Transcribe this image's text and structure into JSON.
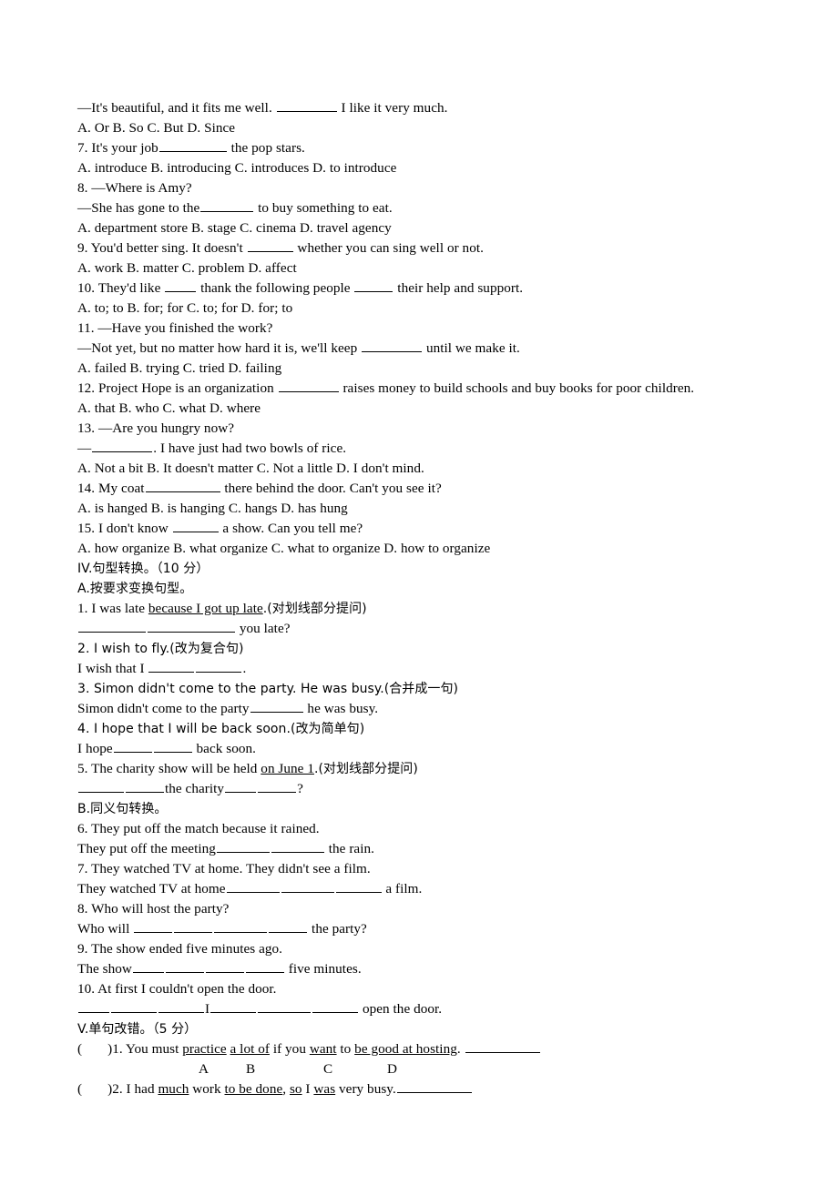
{
  "document": {
    "type": "english-exam-worksheet",
    "language": "en-zh",
    "page_background": "#ffffff",
    "text_color": "#000000"
  },
  "lines": {
    "q6_stem": "—It's beautiful, and it fits me well. ",
    "q6_tail": " I like it very much.",
    "q6_options": "A. Or B. So C. But D. Since",
    "q7_stem": "7. It's your job",
    "q7_tail": " the pop stars.",
    "q7_options": "A. introduce B. introducing C. introduces D. to introduce",
    "q8_stem": "8.  —Where is Amy?",
    "q8_line2_a": "—She has gone to the",
    "q8_line2_b": " to buy something to eat.",
    "q8_options": "A. department store B. stage C. cinema D. travel agency",
    "q9_stem_a": "9. You'd better sing. It doesn't ",
    "q9_stem_b": " whether you can sing well or not.",
    "q9_options": "A. work B. matter C. problem D. affect",
    "q10_a": "10. They'd like ",
    "q10_b": " thank the following people ",
    "q10_c": " their help and support.",
    "q10_options": "A. to; to B. for; for C. to; for D. for; to",
    "q11_stem": "11. —Have you finished the work?",
    "q11_line2_a": "—Not yet, but no matter how hard it is, we'll keep ",
    "q11_line2_b": " until we make it.",
    "q11_options": "A. failed   B. trying  C. tried D. failing",
    "q12_a": "12. Project Hope is an organization ",
    "q12_b": " raises money to build schools and buy books for poor children.",
    "q12_options": "A. that B. who C. what D. where",
    "q13_stem": "13.  —Are you hungry now?",
    "q13_line2_a": "—",
    "q13_line2_b": ". I have just had two bowls of rice.",
    "q13_options": "A. Not a bit B. It doesn't matter C. Not a little D. I don't mind.",
    "q14_a": "14. My coat",
    "q14_b": " there behind the door. Can't you see it?",
    "q14_options": "A. is hanged B. is hanging C. hangs D. has hung",
    "q15_a": "15. I don't know ",
    "q15_b": " a show. Can you tell me?",
    "q15_options": "A. how organize B. what organize C. what to organize D. how to organize"
  },
  "section_iv": {
    "heading": "IV.句型转换。（10 分）",
    "sub_a_heading": "A.按要求变换句型。",
    "a1_prompt_pre": "1. I was late ",
    "a1_prompt_underlined": "because I got up late",
    "a1_prompt_post": ".(对划线部分提问)",
    "a1_answer_tail": " you late?",
    "a2_prompt": "2. I wish to fly.(改为复合句)",
    "a2_answer_pre": "I wish that I ",
    "a2_answer_post": ".",
    "a3_prompt": "3. Simon didn't come to the party. He was busy.(合并成一句)",
    "a3_answer_pre": "Simon didn't come to the party",
    "a3_answer_post": " he was busy.",
    "a4_prompt": "4. I hope that I will be back soon.(改为简单句)",
    "a4_answer_pre": "I hope",
    "a4_answer_post": " back soon.",
    "a5_prompt_pre": "5. The charity show will be held ",
    "a5_prompt_underlined": "on June 1",
    "a5_prompt_post": ".(对划线部分提问)",
    "a5_answer_mid": "the charity",
    "a5_answer_end": "?",
    "sub_b_heading": "B.同义句转换。",
    "b6_prompt": "6. They put off the match because it rained.",
    "b6_answer_pre": "They put off the meeting",
    "b6_answer_post": " the rain.",
    "b7_prompt": "7. They watched TV at home. They didn't see a film.",
    "b7_answer_pre": "They watched TV at home",
    "b7_answer_post": " a film.",
    "b8_prompt": "8. Who will host the party?",
    "b8_answer_pre": "Who will ",
    "b8_answer_post": " the party?",
    "b9_prompt": "9. The show ended five minutes ago.",
    "b9_answer_pre": "The show",
    "b9_answer_post": " five minutes.",
    "b10_prompt": "10. At first I couldn't open the door.",
    "b10_answer_mid": "I",
    "b10_answer_post": " open the door."
  },
  "section_v": {
    "heading": "V.单句改错。（5 分）",
    "q1_prefix": "(",
    "q1_paren_close": ")1. You must ",
    "q1_u_a": "practice",
    "q1_mid1": " ",
    "q1_u_b": "a lot of",
    "q1_mid2": " if you ",
    "q1_u_c": "want",
    "q1_mid3": " to ",
    "q1_u_d": "be good at hosting",
    "q1_end": ". ",
    "choice_labels": [
      "A",
      "B",
      "C",
      "D"
    ],
    "q2_prefix": "(",
    "q2_paren_close": ")2. I had ",
    "q2_u_a": "much",
    "q2_mid1": " work ",
    "q2_u_b": "to be done",
    "q2_mid2": ", ",
    "q2_u_c": "so",
    "q2_mid3": " I ",
    "q2_u_d": "was",
    "q2_end": " very busy."
  }
}
